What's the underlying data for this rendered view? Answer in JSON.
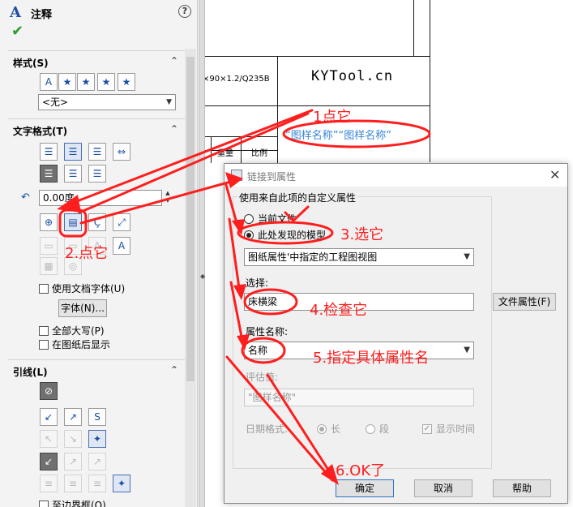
{
  "panel": {
    "title": "注释",
    "title_icon": "A",
    "help_glyph": "?",
    "check_glyph": "✔",
    "style_group": {
      "title": "样式(S)",
      "collapse": "⌃",
      "dropdown_value": "<无>"
    },
    "text_format_group": {
      "title": "文字格式(T)",
      "collapse": "⌃",
      "angle_value": "0.00度",
      "use_doc_font_label": "使用文档字体(U)",
      "font_button_label": "字体(N)...",
      "all_caps_label": "全部大写(P)",
      "behind_sheet_label": "在图纸后显示"
    },
    "leader_group": {
      "title": "引线(L)",
      "collapse": "⌃",
      "bottom_label": "至边界框(O)"
    }
  },
  "drawing": {
    "spec_text": "×90×1.2/Q235B",
    "kytool_text": "KYTool.cn",
    "blue_note": "“图样名称”“图样名称”",
    "col1": "重量",
    "col2": "比例"
  },
  "dialog": {
    "title": "链接到属性",
    "close_glyph": "✕",
    "group_title": "使用来自此项的自定义属性",
    "radio_current_doc": "当前文件",
    "radio_model": "此处发现的模型",
    "model_source_value": "图纸属性'中指定的工程图视图",
    "select_label": "选择:",
    "select_value": "床横梁",
    "file_props_button": "文件属性(F)",
    "prop_name_label": "属性名称:",
    "prop_name_value": "名称",
    "eval_label": "评估值:",
    "eval_value": "\"图样名称\"",
    "date_format_label": "日期格式:",
    "date_long": "长",
    "date_short": "段",
    "show_time": "显示时间",
    "ok_label": "确定",
    "cancel_label": "取消",
    "help_label": "帮助"
  },
  "annotations": {
    "step1": "1点它",
    "step2": "2.点它",
    "step3": "3.选它",
    "step4": "4.检查它",
    "step5": "5.指定具体属性名",
    "step6": "6.OK了",
    "color": "#ff1e1e"
  }
}
